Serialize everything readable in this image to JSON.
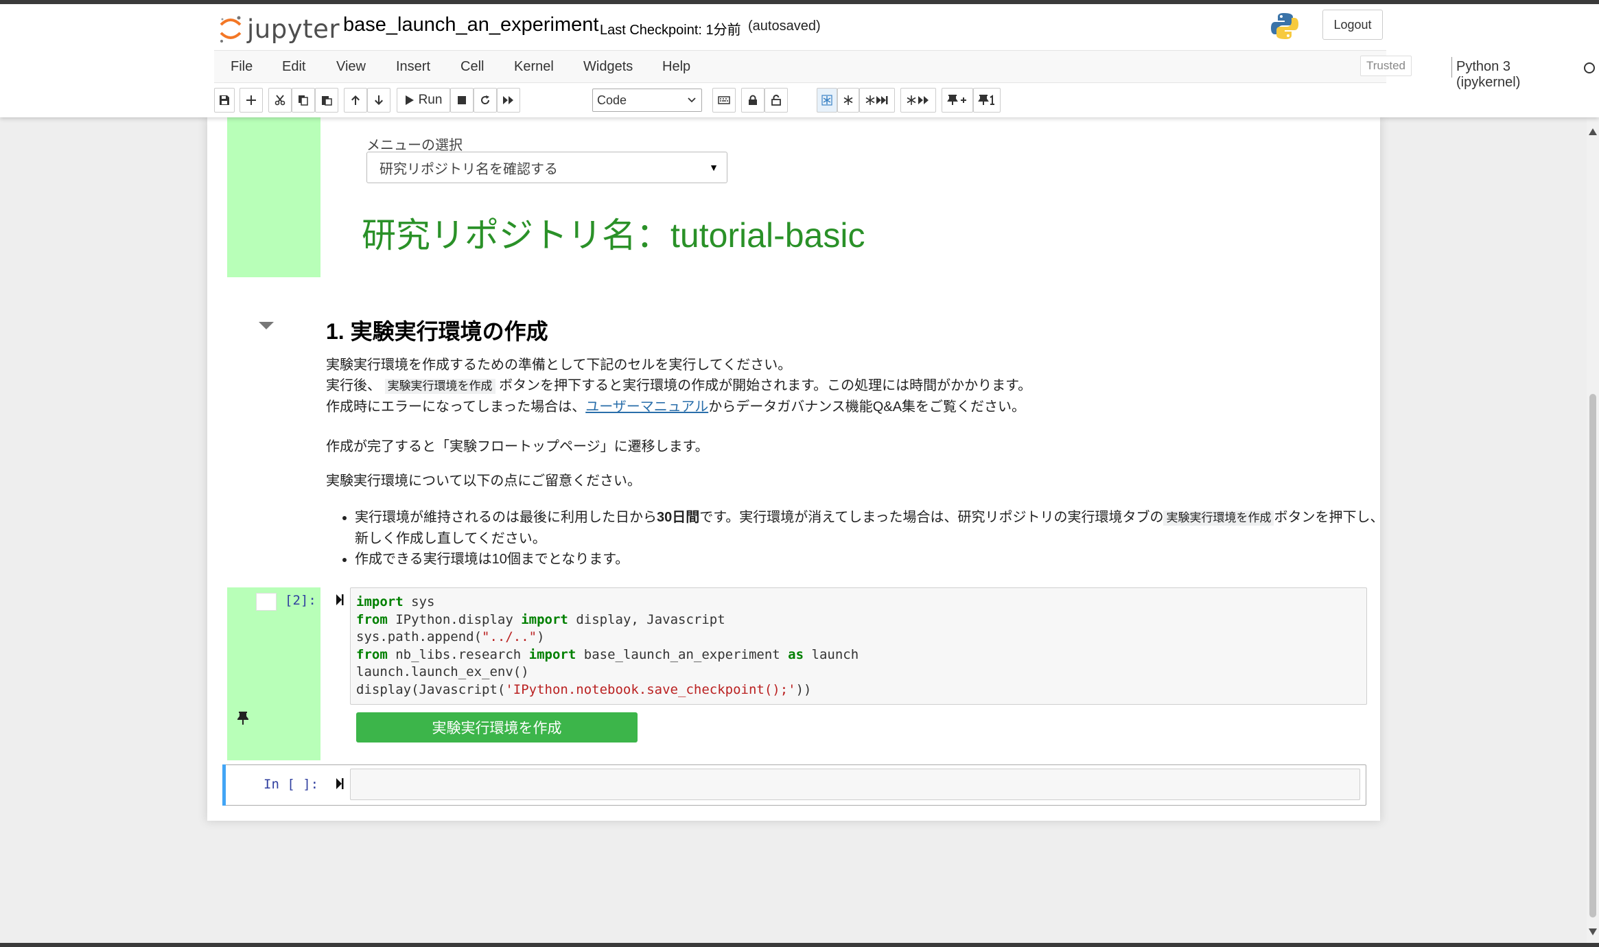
{
  "header": {
    "logo_text": "jupyter",
    "notebook_name": "base_launch_an_experiment",
    "checkpoint": "Last Checkpoint: 1分前",
    "autosave": "(autosaved)",
    "logout_label": "Logout"
  },
  "menubar": {
    "items": [
      "File",
      "Edit",
      "View",
      "Insert",
      "Cell",
      "Kernel",
      "Widgets",
      "Help"
    ],
    "trusted": "Trusted",
    "kernel": "Python 3 (ipykernel)"
  },
  "toolbar": {
    "run_label": "Run",
    "cell_type": "Code"
  },
  "widget_cell": {
    "select_label": "メニューの選択",
    "select_value": "研究リポジトリ名を確認する",
    "repo_heading": "研究リポジトリ名：tutorial-basic"
  },
  "markdown": {
    "heading": "1. 実験実行環境の作成",
    "p1_line1": "実験実行環境を作成するための準備として下記のセルを実行してください。",
    "p1_line2_pre": "実行後、",
    "p1_line2_code": "実験実行環境を作成",
    "p1_line2_post": "ボタンを押下すると実行環境の作成が開始されます。この処理には時間がかかります。",
    "p1_line3_pre": "作成時にエラーになってしまった場合は、",
    "p1_line3_link": "ユーザーマニュアル",
    "p1_line3_post": "からデータガバナンス機能Q&A集をご覧ください。",
    "p2": "作成が完了すると「実験フロートップページ」に遷移します。",
    "p3": "実験実行環境について以下の点にご留意ください。",
    "bullet1_pre": "実行環境が維持されるのは最後に利用した日から",
    "bullet1_bold": "30日間",
    "bullet1_mid": "です。実行環境が消えてしまった場合は、研究リポジトリの実行環境タブの",
    "bullet1_code": "実験実行環境を作成",
    "bullet1_post": "ボタンを押下し、新しく作成し直してください。",
    "bullet2": "作成できる実行環境は10個までとなります。"
  },
  "code_cell": {
    "prompt": "[2]:",
    "button_label": "実験実行環境を作成"
  },
  "empty_cell": {
    "prompt": "In [ ]:"
  },
  "colors": {
    "prompt_highlight": "#b8ffb8",
    "repo_heading": "#2a9128",
    "run_button": "#3cb54a",
    "selected_bar": "#42a5f5"
  }
}
